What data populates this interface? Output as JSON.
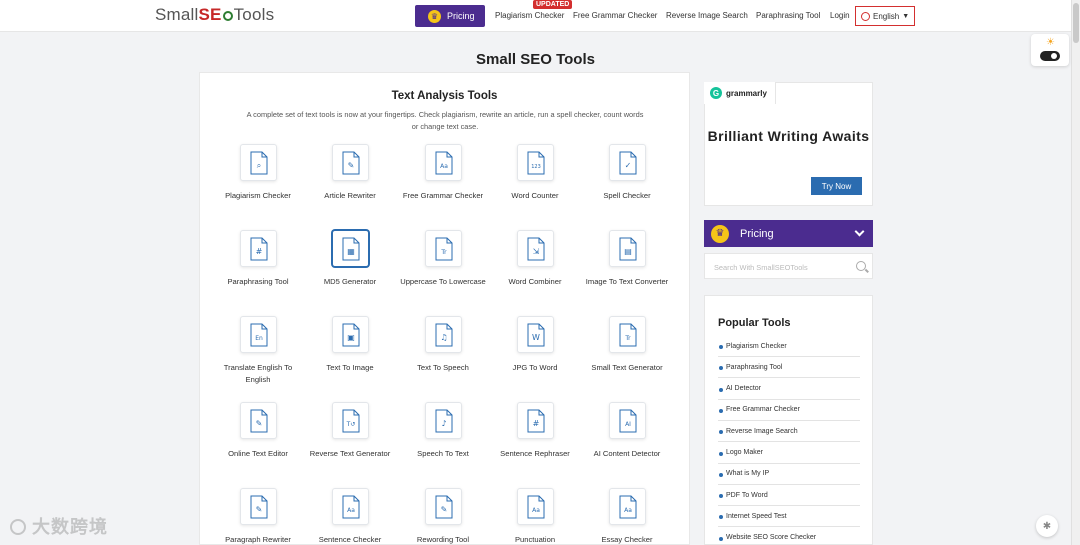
{
  "header": {
    "logo": {
      "part1": "Small",
      "part2": "SE",
      "part3": "Tools"
    },
    "pricing_label": "Pricing",
    "updated_badge": "UPDATED",
    "nav": [
      "Plagiarism Checker",
      "Free Grammar Checker",
      "Reverse Image Search",
      "Paraphrasing Tool",
      "Login"
    ],
    "language": "English"
  },
  "page_title": "Small SEO Tools",
  "main": {
    "section_title": "Text Analysis Tools",
    "description": "A complete set of text tools is now at your fingertips. Check plagiarism, rewrite an article, run a spell checker, count words or change text case.",
    "tools": [
      {
        "label": "Plagiarism Checker",
        "icon": "search-doc-icon"
      },
      {
        "label": "Article Rewriter",
        "icon": "pencil-doc-icon"
      },
      {
        "label": "Free Grammar Checker",
        "icon": "aa-doc-icon"
      },
      {
        "label": "Word Counter",
        "icon": "123-doc-icon"
      },
      {
        "label": "Spell Checker",
        "icon": "check-doc-icon"
      },
      {
        "label": "Paraphrasing Tool",
        "icon": "hash-doc-icon"
      },
      {
        "label": "MD5 Generator",
        "icon": "qr-icon"
      },
      {
        "label": "Uppercase To Lowercase",
        "icon": "tt-doc-icon"
      },
      {
        "label": "Word Combiner",
        "icon": "combine-icon"
      },
      {
        "label": "Image To Text Converter",
        "icon": "image-text-icon"
      },
      {
        "label": "Translate English To English",
        "icon": "translate-icon"
      },
      {
        "label": "Text To Image",
        "icon": "text-image-icon"
      },
      {
        "label": "Text To Speech",
        "icon": "speaker-doc-icon"
      },
      {
        "label": "JPG To Word",
        "icon": "jpg-word-icon"
      },
      {
        "label": "Small Text Generator",
        "icon": "small-tt-icon"
      },
      {
        "label": "Online Text Editor",
        "icon": "editor-icon"
      },
      {
        "label": "Reverse Text Generator",
        "icon": "reverse-text-icon"
      },
      {
        "label": "Speech To Text",
        "icon": "mic-doc-icon"
      },
      {
        "label": "Sentence Rephraser",
        "icon": "hash-doc-icon"
      },
      {
        "label": "AI Content Detector",
        "icon": "ai-chip-icon"
      },
      {
        "label": "Paragraph Rewriter",
        "icon": "pencil-doc-icon"
      },
      {
        "label": "Sentence Checker",
        "icon": "aa-doc-icon"
      },
      {
        "label": "Rewording Tool",
        "icon": "pencil-doc-icon"
      },
      {
        "label": "Punctuation",
        "icon": "aa-doc-icon"
      },
      {
        "label": "Essay Checker",
        "icon": "aa-doc-icon"
      }
    ]
  },
  "sidebar": {
    "ad": {
      "brand": "grammarly",
      "headline": "Brilliant Writing Awaits",
      "cta": "Try Now"
    },
    "pricing_label": "Pricing",
    "search_placeholder": "Search With SmallSEOTools",
    "popular": {
      "title": "Popular Tools",
      "items": [
        "Plagiarism Checker",
        "Paraphrasing Tool",
        "AI Detector",
        "Free Grammar Checker",
        "Reverse Image Search",
        "Logo Maker",
        "What is My IP",
        "PDF To Word",
        "Internet Speed Test",
        "Website SEO Score Checker"
      ]
    }
  },
  "watermark": "大数跨境",
  "colors": {
    "brand_purple": "#4b2c8f",
    "accent_blue": "#2b6cb0",
    "logo_red": "#c62828",
    "badge_red": "#d32f2f",
    "crown_gold": "#f5c518"
  }
}
